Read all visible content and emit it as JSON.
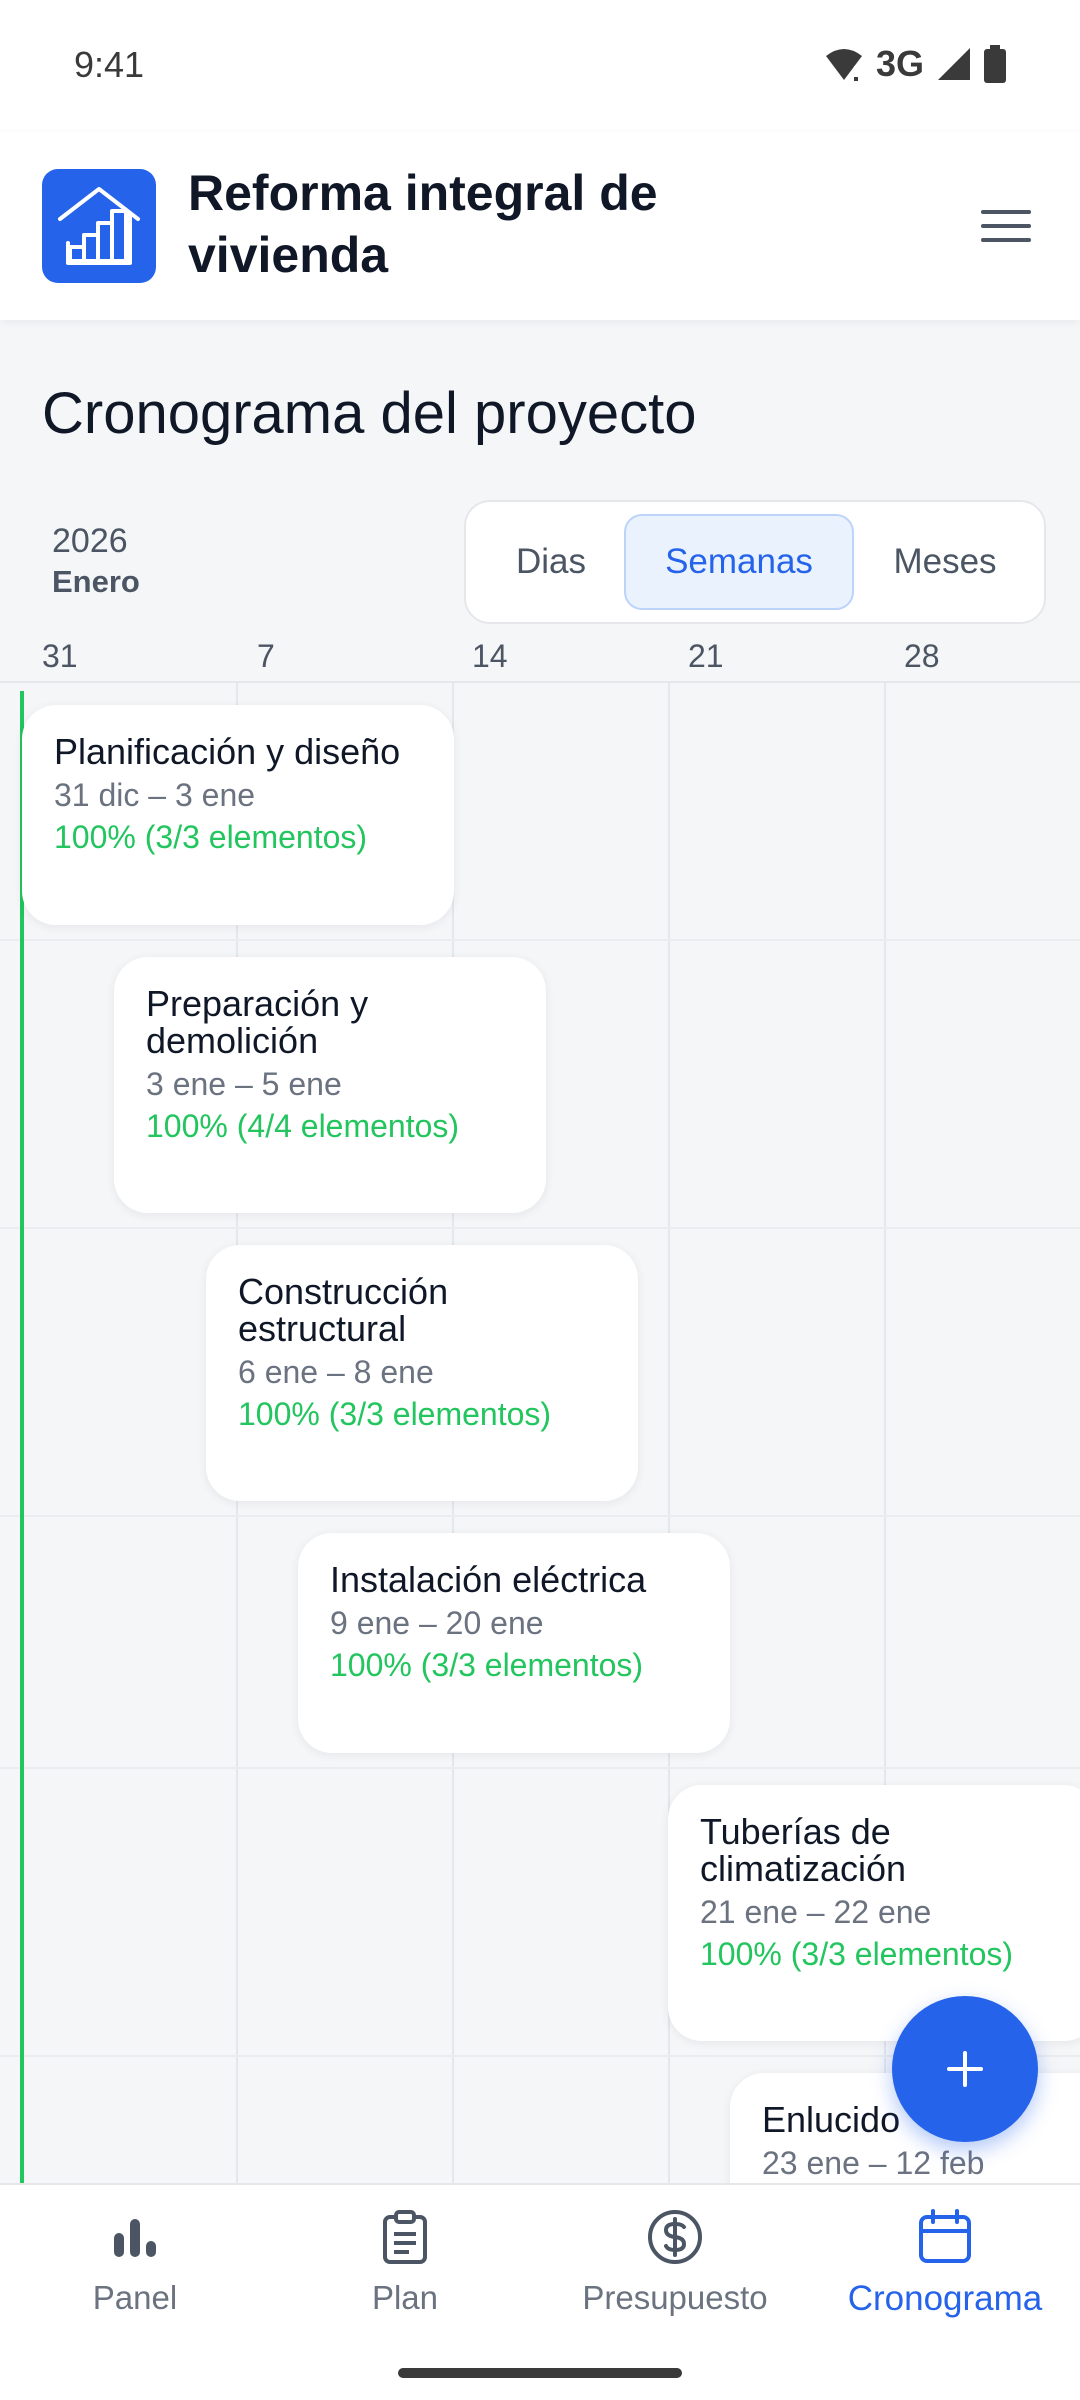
{
  "status": {
    "time": "9:41",
    "network": "3G"
  },
  "app": {
    "title": "Reforma integral de vivienda",
    "logo_icon": "house-chart-icon",
    "accent": "#2563eb"
  },
  "page": {
    "title": "Cronograma del proyecto"
  },
  "timeline": {
    "year": "2026",
    "month": "Enero",
    "views": [
      {
        "label": "Dias",
        "active": false
      },
      {
        "label": "Semanas",
        "active": true
      },
      {
        "label": "Meses",
        "active": false
      }
    ],
    "weeks": [
      "31",
      "7",
      "14",
      "21",
      "28"
    ]
  },
  "tasks": [
    {
      "name": "Planificación y diseño",
      "dates": "31 dic – 3 ene",
      "progress": "100% (3/3 elementos)"
    },
    {
      "name": "Preparación y demolición",
      "dates": "3 ene – 5 ene",
      "progress": "100% (4/4 elementos)"
    },
    {
      "name": "Construcción estructural",
      "dates": "6 ene – 8 ene",
      "progress": "100% (3/3 elementos)"
    },
    {
      "name": "Instalación eléctrica",
      "dates": "9 ene – 20 ene",
      "progress": "100% (3/3 elementos)"
    },
    {
      "name": "Tuberías de climatización",
      "dates": "21 ene – 22 ene",
      "progress": "100% (3/3 elementos)"
    },
    {
      "name": "Enlucido",
      "dates": "23 ene – 12 feb",
      "progress": ""
    }
  ],
  "nav": [
    {
      "label": "Panel",
      "icon": "bar-chart-icon",
      "active": false
    },
    {
      "label": "Plan",
      "icon": "clipboard-icon",
      "active": false
    },
    {
      "label": "Presupuesto",
      "icon": "dollar-circle-icon",
      "active": false
    },
    {
      "label": "Cronograma",
      "icon": "calendar-icon",
      "active": true
    }
  ]
}
